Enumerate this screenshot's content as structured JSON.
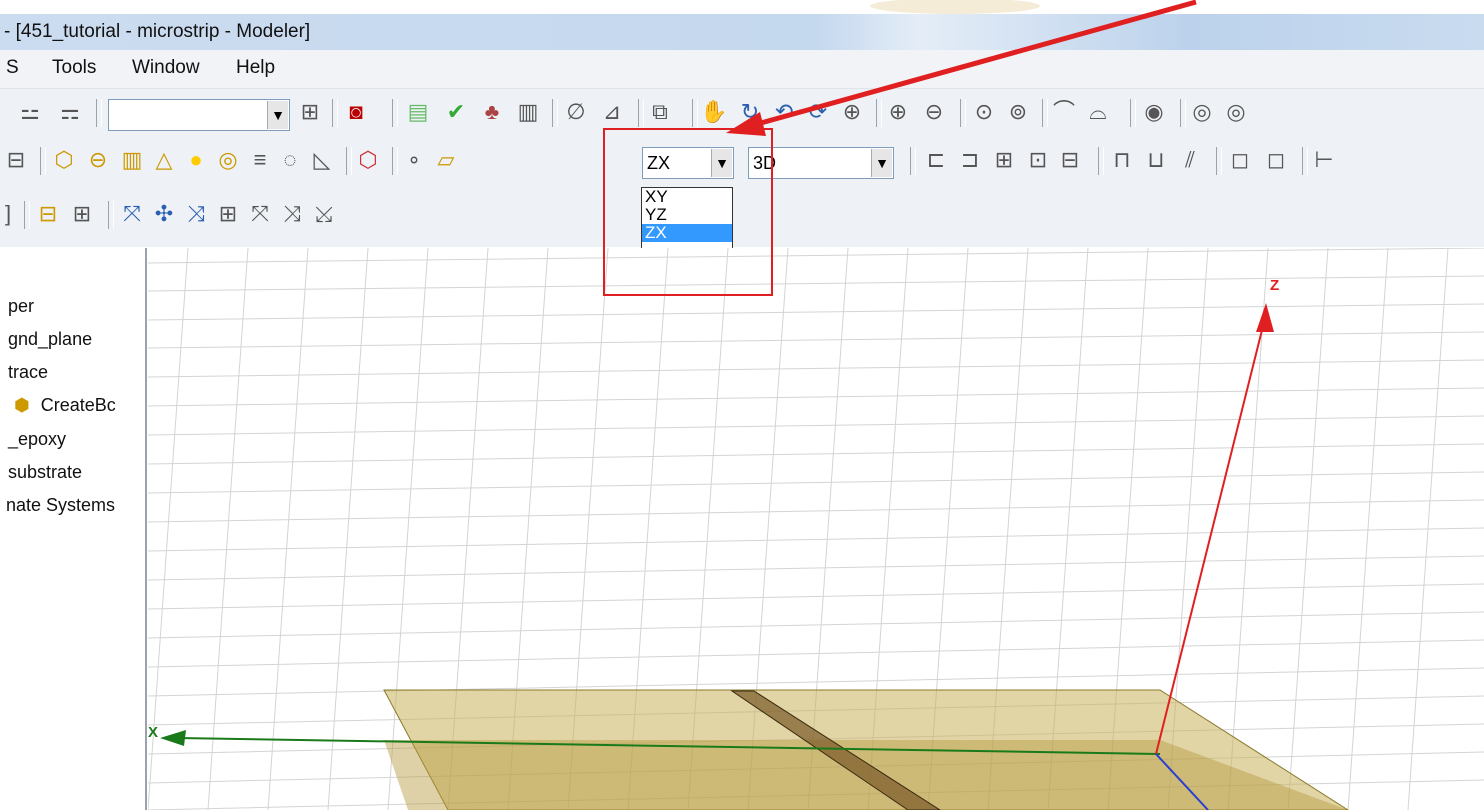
{
  "window": {
    "title": "- [451_tutorial - microstrip - Modeler]"
  },
  "menu": [
    "S",
    "Tools",
    "Window",
    "Help"
  ],
  "toolbar": {
    "plane_combo": {
      "value": "ZX",
      "options": [
        "XY",
        "YZ",
        "ZX"
      ],
      "selected": "ZX"
    },
    "view_combo": {
      "value": "3D"
    },
    "empty_combo": {
      "value": ""
    }
  },
  "tree": {
    "items": [
      "per",
      "gnd_plane",
      "trace",
      "CreateBc",
      "_epoxy",
      "substrate",
      "nate Systems"
    ]
  },
  "viewport": {
    "axis_z": "Z",
    "axis_x": "X"
  },
  "colors": {
    "annotation": "#e02020",
    "axis_z": "#e02020",
    "axis_x": "#1a7a1a",
    "highlight": "#3399ff"
  },
  "icons": {
    "toolbar1": [
      "toolbar-icon-a",
      "toolbar-icon-b",
      "toolbar-icon-c",
      "toolbar-icon-d",
      "notepad-icon",
      "check-icon",
      "puzzle-icon",
      "document-icon",
      "curve-icon",
      "graph-icon",
      "copy-icon",
      "pan-hand-icon",
      "rotate-icon",
      "orbit-icon",
      "spin-icon",
      "zoom-icon",
      "zoom-in-icon",
      "zoom-out-icon",
      "zoom-fit-icon",
      "zoom-all-icon",
      "undo-view-icon",
      "redo-view-icon",
      "eye-icon",
      "hide-icon",
      "show-icon"
    ],
    "toolbar2": [
      "box-icon",
      "cylinder-icon",
      "cone-icon",
      "triangle-icon",
      "sphere-icon",
      "torus-icon",
      "helix-icon",
      "spiral-icon",
      "bondwire-icon",
      "cube-icon",
      "point-icon",
      "plane-icon"
    ]
  }
}
